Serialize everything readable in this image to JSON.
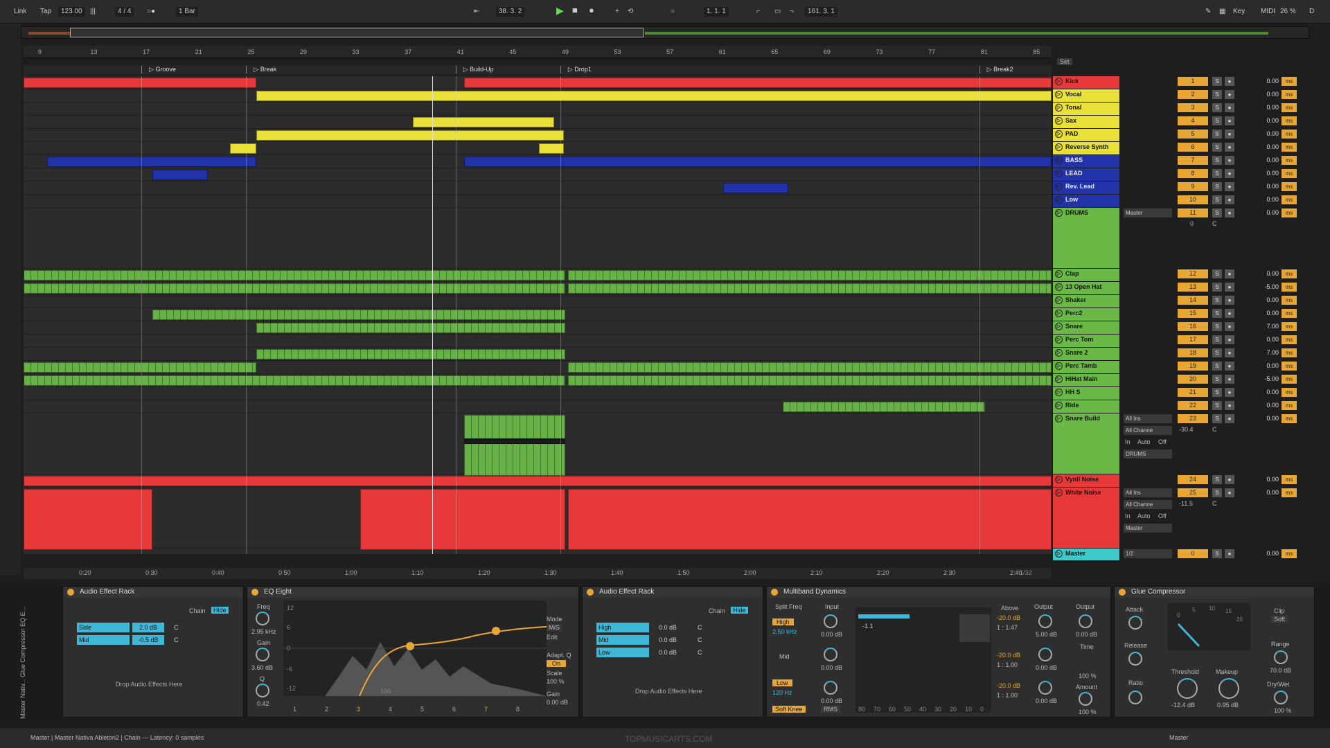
{
  "topbar": {
    "link": "Link",
    "tap": "Tap",
    "tempo": "123.00",
    "time_sig": "4 / 4",
    "quant": "1 Bar",
    "pos": "38.  3.  2",
    "loop_start": "1.   1.   1",
    "loop_len": "161.   3.   1",
    "key": "Key",
    "midi": "MIDI",
    "cpu": "26 %",
    "d": "D"
  },
  "ruler": [
    "9",
    "13",
    "17",
    "21",
    "25",
    "29",
    "33",
    "37",
    "41",
    "45",
    "49",
    "53",
    "57",
    "61",
    "65",
    "69",
    "73",
    "77",
    "81",
    "85"
  ],
  "set_label": "Set",
  "locators": [
    {
      "name": "Groove",
      "bar": 17
    },
    {
      "name": "Break",
      "bar": 25
    },
    {
      "name": "Build-Up",
      "bar": 41
    },
    {
      "name": "Drop1",
      "bar": 49
    },
    {
      "name": "Break2",
      "bar": 81
    }
  ],
  "tracks": [
    {
      "name": "Kick",
      "color": "#e8393a",
      "num": "1",
      "vol": "0.00"
    },
    {
      "name": "Vocal",
      "color": "#e9e13a",
      "num": "2",
      "vol": "0.00"
    },
    {
      "name": "Tonal",
      "color": "#e9e13a",
      "num": "3",
      "vol": "0.00"
    },
    {
      "name": "Sax",
      "color": "#e9e13a",
      "num": "4",
      "vol": "0.00"
    },
    {
      "name": "PAD",
      "color": "#e9e13a",
      "num": "5",
      "vol": "0.00"
    },
    {
      "name": "Reverse Synth",
      "color": "#e9e13a",
      "num": "6",
      "vol": "0.00"
    },
    {
      "name": "BASS",
      "color": "#2233aa",
      "num": "7",
      "vol": "0.00"
    },
    {
      "name": "LEAD",
      "color": "#2233aa",
      "num": "8",
      "vol": "0.00"
    },
    {
      "name": "Rev. Lead",
      "color": "#2233aa",
      "num": "9",
      "vol": "0.00"
    },
    {
      "name": "Low",
      "color": "#2233aa",
      "num": "10",
      "vol": "0.00"
    },
    {
      "name": "DRUMS",
      "color": "#6ab946",
      "num": "11",
      "vol": "0.00",
      "io": "Master"
    },
    {
      "name": "Clap",
      "color": "#6ab946",
      "num": "12",
      "vol": "0.00"
    },
    {
      "name": "13 Open Hat",
      "color": "#6ab946",
      "num": "13",
      "vol": "-5.00"
    },
    {
      "name": "Shaker",
      "color": "#6ab946",
      "num": "14",
      "vol": "0.00"
    },
    {
      "name": "Perc2",
      "color": "#6ab946",
      "num": "15",
      "vol": "0.00"
    },
    {
      "name": "Snare",
      "color": "#6ab946",
      "num": "16",
      "vol": "7.00"
    },
    {
      "name": "Perc Tom",
      "color": "#6ab946",
      "num": "17",
      "vol": "0.00"
    },
    {
      "name": "Snare 2",
      "color": "#6ab946",
      "num": "18",
      "vol": "7.00"
    },
    {
      "name": "Perc Tamb",
      "color": "#6ab946",
      "num": "19",
      "vol": "0.00"
    },
    {
      "name": "HiHat Main",
      "color": "#6ab946",
      "num": "20",
      "vol": "-5.00"
    },
    {
      "name": "HH S",
      "color": "#6ab946",
      "num": "21",
      "vol": "0.00"
    },
    {
      "name": "Ride",
      "color": "#6ab946",
      "num": "22",
      "vol": "0.00"
    },
    {
      "name": "Snare Build",
      "color": "#6ab946",
      "num": "23",
      "vol": "0.00",
      "io": "All Ins",
      "io2": "All Channe",
      "io3": "DRUMS",
      "send": "-30.4"
    },
    {
      "name": "Vynil Noise",
      "color": "#e8393a",
      "num": "24",
      "vol": "0.00"
    },
    {
      "name": "White Noise",
      "color": "#e8393a",
      "num": "25",
      "vol": "0.00",
      "io": "All Ins",
      "io2": "All Channe",
      "io3": "Master",
      "send": "-11.5"
    },
    {
      "name": "Master",
      "color": "#3ec8c8",
      "num": "0",
      "vol": "0.00",
      "io": "1/2"
    }
  ],
  "mixer": {
    "s": "S",
    "ms": "ms",
    "c": "C",
    "in": "In",
    "auto": "Auto",
    "off": "Off",
    "zero": "0"
  },
  "timeline": [
    "0:20",
    "0:30",
    "0:40",
    "0:50",
    "1:00",
    "1:10",
    "1:20",
    "1:30",
    "1:40",
    "1:50",
    "2:00",
    "2:10",
    "2:20",
    "2:30",
    "2:40"
  ],
  "timeline_end": "1/32",
  "devices": {
    "rack1": {
      "title": "Audio Effect Rack",
      "chain": "Chain",
      "hide": "Hide",
      "rows": [
        {
          "name": "Side",
          "val": "2.0 dB",
          "pan": "C"
        },
        {
          "name": "Mid",
          "val": "-0.5 dB",
          "pan": "C"
        }
      ],
      "drop": "Drop Audio Effects Here"
    },
    "eq": {
      "title": "EQ Eight",
      "freq_lbl": "Freq",
      "freq": "2.95 kHz",
      "gain_lbl": "Gain",
      "gain": "3.60 dB",
      "q_lbl": "Q",
      "q": "0.42",
      "mode_lbl": "Mode",
      "mode": "M/S",
      "edit_lbl": "Edit",
      "adapt_lbl": "Adapt. Q",
      "adapt": "On",
      "scale_lbl": "Scale",
      "scale": "100 %",
      "gain2_lbl": "Gain",
      "gain2": "0.00 dB",
      "db": [
        "12",
        "6",
        "0",
        "-6",
        "-12"
      ],
      "bands": [
        "1",
        "2",
        "3",
        "4",
        "5",
        "6",
        "7",
        "8"
      ],
      "hz": "100"
    },
    "rack2": {
      "title": "Audio Effect Rack",
      "chain": "Chain",
      "hide": "Hide",
      "rows": [
        {
          "name": "High",
          "val": "0.0 dB",
          "pan": "C"
        },
        {
          "name": "Mid",
          "val": "0.0 dB",
          "pan": "C"
        },
        {
          "name": "Low",
          "val": "0.0 dB",
          "pan": "C"
        }
      ],
      "drop": "Drop Audio Effects Here"
    },
    "mbd": {
      "title": "Multiband Dynamics",
      "split": "Split Freq",
      "input": "Input",
      "above": "Above",
      "output": "Output",
      "high": "High",
      "f1": "2.50 kHz",
      "mid": "Mid",
      "low": "Low",
      "f2": "120 Hz",
      "soft": "Soft Knee",
      "rms": "RMS",
      "in_vals": [
        "0.00 dB",
        "0.00 dB",
        "0.00 dB"
      ],
      "above_vals": [
        "-20.0 dB",
        "1 : 1.47",
        "-20.0 dB",
        "1 : 1.00",
        "-20.0 dB",
        "1 : 1.00"
      ],
      "out_vals": [
        "5.00 dB",
        "0.00 dB",
        "0.00 dB"
      ],
      "out2": "0.00 dB",
      "time": "Time",
      "t100": "100 %",
      "amount": "Amount",
      "a100": "100 %",
      "meter": "-1.1",
      "scale": [
        "80",
        "70",
        "60",
        "50",
        "40",
        "30",
        "20",
        "10",
        "0"
      ]
    },
    "glue": {
      "title": "Glue Compressor",
      "attack": "Attack",
      "release": "Release",
      "ratio": "Ratio",
      "threshold": "Threshold",
      "thr_val": "-12.4 dB",
      "makeup": "Makeup",
      "mk_val": "0.95 dB",
      "clip": "Clip",
      "soft": "Soft",
      "range": "Range",
      "range_val": "70.0 dB",
      "drywet": "Dry/Wet",
      "dw_val": "100 %",
      "meter": [
        "0",
        "5",
        "10",
        "15",
        "20"
      ]
    }
  },
  "status": {
    "text": "Master | Master Nativa Ableton2 | Chain --- Latency: 0 samples",
    "watermark": "TOPMUSICARTS.COM",
    "right": "Master"
  },
  "sidebar": {
    "labels": "Master Nativ...  Glue Compressor  EQ E..."
  }
}
